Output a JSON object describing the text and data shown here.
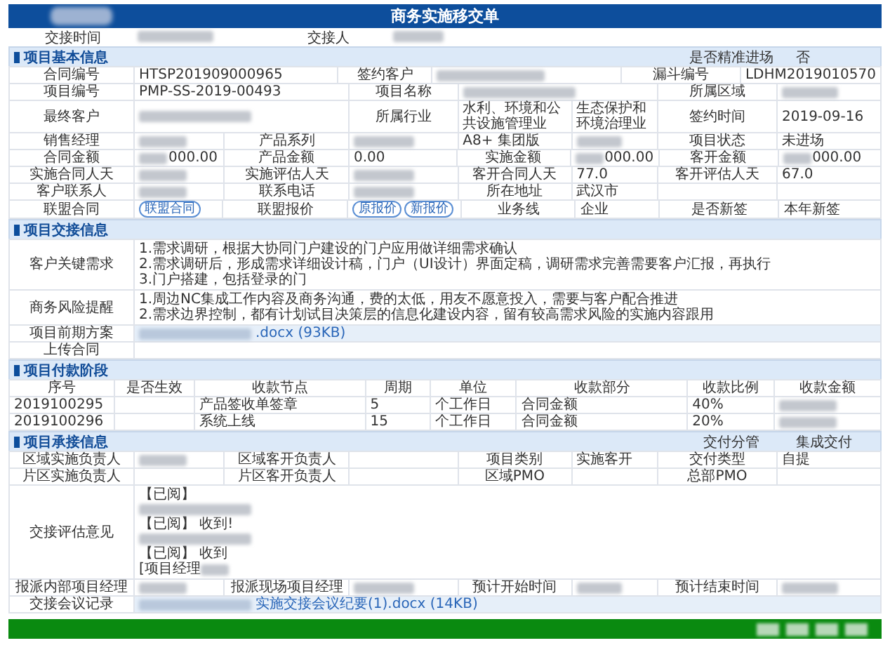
{
  "window": {
    "title": "商务实施移交单"
  },
  "meta": [
    {
      "kind": "label",
      "text": "交接时间"
    },
    {
      "kind": "blur"
    },
    {
      "kind": "label",
      "text": "交接人"
    },
    {
      "kind": "blur"
    }
  ],
  "sections": [
    {
      "kind": "fields",
      "title": "项目基本信息",
      "aside": {
        "label": "是否精准进场",
        "value": "否"
      },
      "blocks": [
        {
          "rows": [
            [
              {
                "kind": "label",
                "text": "合同编号"
              },
              {
                "kind": "value",
                "text": "HTSP201909000965"
              },
              {
                "kind": "label",
                "text": "签约客户"
              },
              {
                "kind": "blur"
              },
              {
                "kind": "label",
                "text": "漏斗编号"
              },
              {
                "kind": "value",
                "text": "LDHM2019010570"
              }
            ],
            [
              {
                "kind": "label",
                "text": "项目编号"
              },
              {
                "kind": "value",
                "text": "PMP-SS-2019-00493"
              },
              {
                "kind": "label",
                "text": "项目名称"
              },
              {
                "kind": "blur"
              },
              {
                "kind": "label",
                "text": "所属区域"
              },
              {
                "kind": "blur"
              }
            ]
          ]
        },
        {
          "rows": [
            [
              {
                "kind": "label",
                "text": "最终客户"
              },
              {
                "kind": "blur"
              },
              {
                "kind": "label",
                "text": "所属行业"
              },
              {
                "kind": "value",
                "text": "水利、环境和公共设施管理业"
              },
              {
                "kind": "value",
                "text": "生态保护和环境治理业"
              },
              {
                "kind": "label",
                "text": "签约时间"
              },
              {
                "kind": "value",
                "text": "2019-09-16"
              }
            ]
          ]
        },
        {
          "rows": [
            [
              {
                "kind": "label",
                "text": "销售经理"
              },
              {
                "kind": "blur"
              },
              {
                "kind": "label",
                "text": "产品系列"
              },
              {
                "kind": "blur"
              },
              {
                "kind": "value",
                "text": "A8+ 集团版"
              },
              {
                "kind": "blur"
              },
              {
                "kind": "label",
                "text": "项目状态"
              },
              {
                "kind": "value",
                "text": "未进场"
              }
            ],
            [
              {
                "kind": "label",
                "text": "合同金额"
              },
              {
                "kind": "blur_text",
                "text": "000.00"
              },
              {
                "kind": "label",
                "text": "产品金额"
              },
              {
                "kind": "value",
                "text": "0.00"
              },
              {
                "kind": "label",
                "text": "实施金额"
              },
              {
                "kind": "blur_text",
                "text": "000.00"
              },
              {
                "kind": "label",
                "text": "客开金额"
              },
              {
                "kind": "blur_text",
                "text": "000.00"
              }
            ],
            [
              {
                "kind": "label",
                "text": "实施合同人天"
              },
              {
                "kind": "blur"
              },
              {
                "kind": "label",
                "text": "实施评估人天"
              },
              {
                "kind": "blur"
              },
              {
                "kind": "label",
                "text": "客开合同人天"
              },
              {
                "kind": "value",
                "text": "77.0"
              },
              {
                "kind": "label",
                "text": "客开评估人天"
              },
              {
                "kind": "value",
                "text": "67.0"
              }
            ],
            [
              {
                "kind": "label",
                "text": "客户联系人"
              },
              {
                "kind": "blur"
              },
              {
                "kind": "label",
                "text": "联系电话"
              },
              {
                "kind": "blur"
              },
              {
                "kind": "label",
                "text": "所在地址"
              },
              {
                "kind": "value",
                "text": "武汉市"
              },
              {
                "kind": "empty"
              },
              {
                "kind": "empty"
              }
            ],
            [
              {
                "kind": "label",
                "text": "联盟合同"
              },
              {
                "kind": "buttons",
                "buttons": [
                  "联盟合同"
                ]
              },
              {
                "kind": "label",
                "text": "联盟报价"
              },
              {
                "kind": "buttons",
                "buttons": [
                  "原报价",
                  "新报价"
                ]
              },
              {
                "kind": "label",
                "text": "业务线"
              },
              {
                "kind": "value",
                "text": "企业"
              },
              {
                "kind": "label",
                "text": "是否新签"
              },
              {
                "kind": "value",
                "text": "本年新签"
              }
            ]
          ]
        }
      ]
    },
    {
      "kind": "fields",
      "title": "项目交接信息",
      "blocks": [
        {
          "rows": [
            [
              {
                "kind": "label",
                "text": "客户关键需求"
              },
              {
                "kind": "lines",
                "lines": [
                  {
                    "kind": "text",
                    "text": "1.需求调研，根据大协同门户建设的门户应用做详细需求确认"
                  },
                  {
                    "kind": "text",
                    "text": "2.需求调研后，形成需求详细设计稿，门户（UI设计）界面定稿，调研需求完善需要客户汇报，再执行"
                  },
                  {
                    "kind": "text",
                    "text": "3.门户搭建，包括登录的门"
                  }
                ]
              }
            ],
            [
              {
                "kind": "label",
                "text": "商务风险提醒"
              },
              {
                "kind": "lines",
                "lines": [
                  {
                    "kind": "text",
                    "text": "1.周边NC集成工作内容及商务沟通，费的太低，用友不愿意投入，需要与客户配合推进"
                  },
                  {
                    "kind": "text",
                    "text": "2.需求边界控制，都有计划试目决策层的信息化建设内容，留有较高需求风险的实施内容跟用"
                  }
                ]
              }
            ],
            [
              {
                "kind": "label",
                "text": "项目前期方案"
              },
              {
                "kind": "file",
                "text": ".docx (93KB)"
              }
            ],
            [
              {
                "kind": "label",
                "text": "上传合同"
              },
              {
                "kind": "empty"
              }
            ]
          ]
        }
      ]
    },
    {
      "kind": "table",
      "title": "项目付款阶段",
      "columns": [
        "序号",
        "是否生效",
        "收款节点",
        "周期",
        "单位",
        "收款部分",
        "收款比例",
        "收款金额"
      ],
      "rows": [
        [
          {
            "kind": "value",
            "text": "2019100295"
          },
          {
            "kind": "empty"
          },
          {
            "kind": "value",
            "text": "产品签收单签章"
          },
          {
            "kind": "value",
            "text": "5"
          },
          {
            "kind": "value",
            "text": "个工作日"
          },
          {
            "kind": "value",
            "text": "合同金额"
          },
          {
            "kind": "value",
            "text": "40%"
          },
          {
            "kind": "blur"
          }
        ],
        [
          {
            "kind": "value",
            "text": "2019100296"
          },
          {
            "kind": "empty"
          },
          {
            "kind": "value",
            "text": "系统上线"
          },
          {
            "kind": "value",
            "text": "15"
          },
          {
            "kind": "value",
            "text": "个工作日"
          },
          {
            "kind": "value",
            "text": "合同金额"
          },
          {
            "kind": "value",
            "text": "20%"
          },
          {
            "kind": "blur"
          }
        ]
      ]
    },
    {
      "kind": "fields",
      "title": "项目承接信息",
      "aside": {
        "label": "交付分管",
        "value": "集成交付"
      },
      "blocks": [
        {
          "rows": [
            [
              {
                "kind": "label",
                "text": "区域实施负责人"
              },
              {
                "kind": "blur"
              },
              {
                "kind": "label",
                "text": "区域客开负责人"
              },
              {
                "kind": "empty"
              },
              {
                "kind": "label",
                "text": "项目类别"
              },
              {
                "kind": "value",
                "text": "实施客开"
              },
              {
                "kind": "label",
                "text": "交付类型"
              },
              {
                "kind": "value",
                "text": "自提"
              }
            ],
            [
              {
                "kind": "label",
                "text": "片区实施负责人"
              },
              {
                "kind": "empty"
              },
              {
                "kind": "label",
                "text": "片区客开负责人"
              },
              {
                "kind": "empty"
              },
              {
                "kind": "label",
                "text": "区域PMO"
              },
              {
                "kind": "empty"
              },
              {
                "kind": "label",
                "text": "总部PMO"
              },
              {
                "kind": "empty"
              }
            ]
          ]
        },
        {
          "rows": [
            [
              {
                "kind": "label",
                "text": "交接评估意见"
              },
              {
                "kind": "lines",
                "lines": [
                  {
                    "kind": "text",
                    "text": "【已阅】"
                  },
                  {
                    "kind": "blur"
                  },
                  {
                    "kind": "text",
                    "text": "【已阅】 收到!"
                  },
                  {
                    "kind": "blur"
                  },
                  {
                    "kind": "text",
                    "text": "【已阅】 收到"
                  },
                  {
                    "kind": "text_blur",
                    "text": "[项目经理"
                  }
                ]
              }
            ]
          ]
        },
        {
          "rows": [
            [
              {
                "kind": "label",
                "text": "报派内部项目经理"
              },
              {
                "kind": "blur"
              },
              {
                "kind": "label",
                "text": "报派现场项目经理"
              },
              {
                "kind": "blur"
              },
              {
                "kind": "label",
                "text": "预计开始时间"
              },
              {
                "kind": "blur"
              },
              {
                "kind": "label",
                "text": "预计结束时间"
              },
              {
                "kind": "blur"
              }
            ]
          ]
        },
        {
          "rows": [
            [
              {
                "kind": "label",
                "text": "交接会议记录"
              },
              {
                "kind": "file",
                "text": "实施交接会议纪要(1).docx (14KB)"
              }
            ]
          ]
        }
      ]
    }
  ]
}
